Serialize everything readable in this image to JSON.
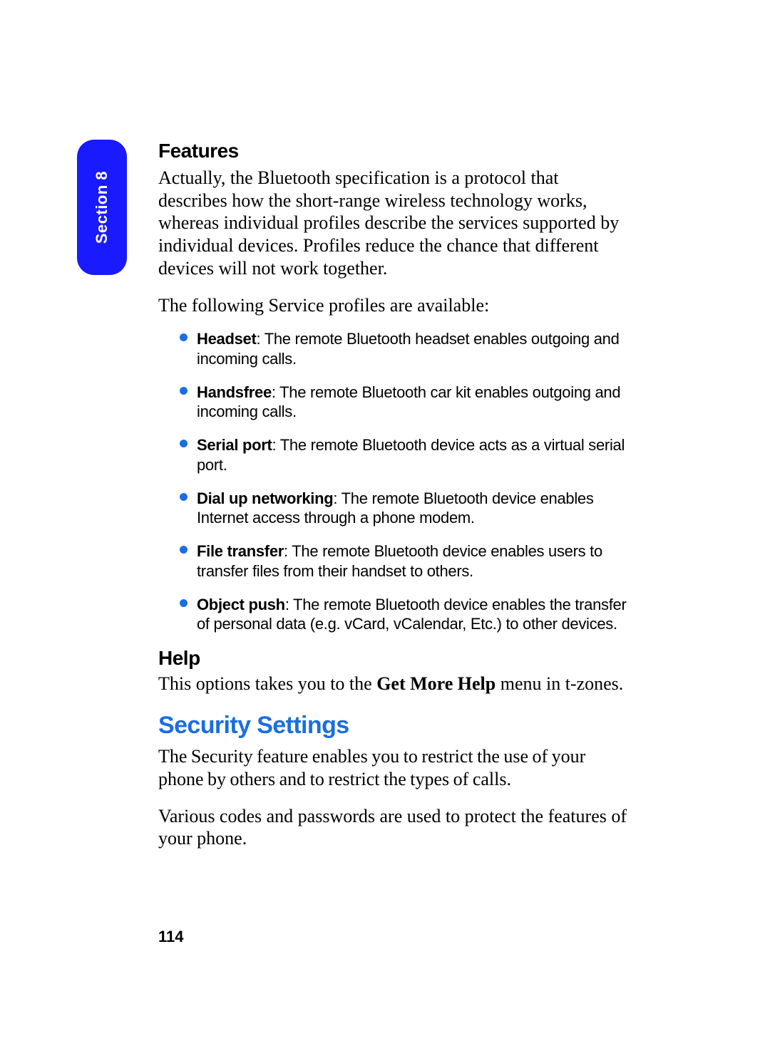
{
  "tab": {
    "label": "Section 8"
  },
  "headings": {
    "features": "Features",
    "help": "Help",
    "security": "Security Settings"
  },
  "body": {
    "features_p1": "Actually, the Bluetooth specification is a protocol that describes how the short-range wireless technology works, whereas individual profiles describe the services supported by individual devices. Profiles reduce the chance that different devices will not work together.",
    "features_p2": "The following Service profiles are available:",
    "help_prefix": "This options takes you to the ",
    "help_bold": "Get More Help",
    "help_suffix": " menu in t-zones.",
    "security_p1": "The Security feature enables you to restrict the use of your phone by others and to restrict the types of calls.",
    "security_p2": "Various codes and passwords are used to protect the features of your phone."
  },
  "profiles": [
    {
      "term": "Headset",
      "desc": ": The remote Bluetooth headset enables outgoing and incoming calls."
    },
    {
      "term": "Handsfree",
      "desc": ": The remote Bluetooth car kit enables outgoing and incoming calls."
    },
    {
      "term": "Serial port",
      "desc": ": The remote Bluetooth device acts as a virtual serial port."
    },
    {
      "term": "Dial up networking",
      "desc": ": The remote Bluetooth device enables Internet access through a phone modem."
    },
    {
      "term": "File transfer",
      "desc": ": The remote Bluetooth device enables users to transfer files from their handset to others."
    },
    {
      "term": "Object push",
      "desc": ": The remote Bluetooth device enables the transfer of personal data (e.g. vCard, vCalendar, Etc.) to other devices."
    }
  ],
  "page_number": "114"
}
